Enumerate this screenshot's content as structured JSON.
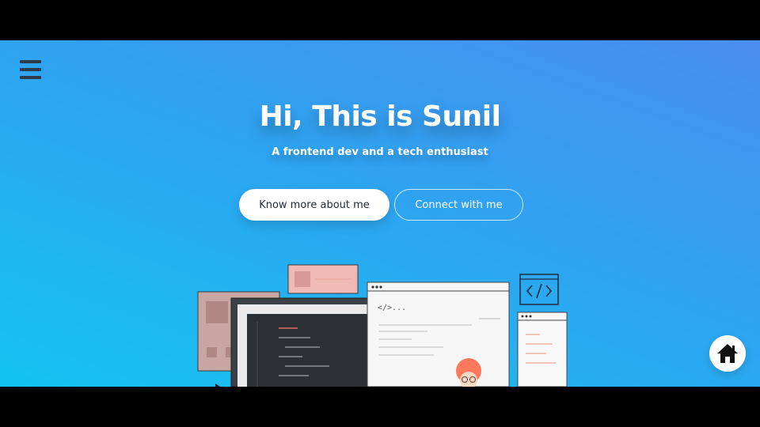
{
  "nav": {
    "menu_icon": "hamburger-menu-icon"
  },
  "hero": {
    "title": "Hi, This is Sunil",
    "subtitle": "A frontend dev and a tech enthusiast",
    "primary_button": "Know more about me",
    "secondary_button": "Connect with me"
  },
  "illustration": {
    "code_tag": "</>..."
  },
  "floating": {
    "home_icon": "home-icon"
  },
  "colors": {
    "gradient_top_right": "#4a8ef0",
    "gradient_bottom_left": "#13c4f2",
    "menu_icon": "#2f3a4a"
  }
}
